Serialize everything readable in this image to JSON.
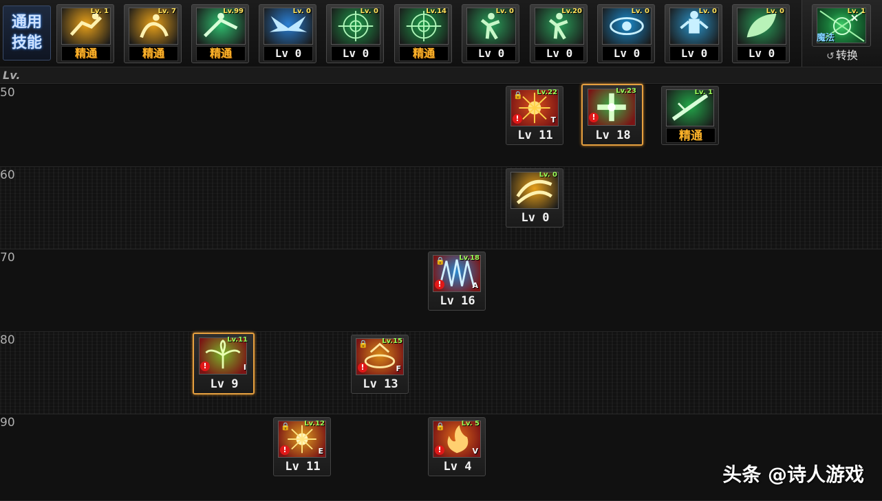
{
  "top_bar": {
    "general_label_line1": "通用",
    "general_label_line2": "技能",
    "slots": [
      {
        "icon": "runner-icon",
        "lv": "Lv. 1",
        "level": "精通",
        "color": "#e8a11a",
        "mastery": true
      },
      {
        "icon": "crouch-icon",
        "lv": "Lv. 7",
        "level": "精通",
        "color": "#e8a11a",
        "mastery": true
      },
      {
        "icon": "strike-icon",
        "lv": "Lv.99",
        "level": "精通",
        "color": "#2fbf6f",
        "mastery": true
      },
      {
        "icon": "wings-icon",
        "lv": "Lv. 0",
        "level": "Lv 0",
        "color": "#2a7fd4",
        "mastery": false
      },
      {
        "icon": "target-icon",
        "lv": "Lv. 0",
        "level": "Lv 0",
        "color": "#1e9a4a",
        "mastery": false
      },
      {
        "icon": "target-icon",
        "lv": "Lv.14",
        "level": "精通",
        "color": "#1e9a4a",
        "mastery": true
      },
      {
        "icon": "figure-icon",
        "lv": "Lv. 0",
        "level": "Lv 0",
        "color": "#2aa05a",
        "mastery": false
      },
      {
        "icon": "figure-icon",
        "lv": "Lv.20",
        "level": "Lv 0",
        "color": "#2aa05a",
        "mastery": false
      },
      {
        "icon": "eye-icon",
        "lv": "Lv. 0",
        "level": "Lv 0",
        "color": "#1a8acb",
        "mastery": false
      },
      {
        "icon": "guardian-icon",
        "lv": "Lv. 0",
        "level": "Lv 0",
        "color": "#2a93c8",
        "mastery": false
      },
      {
        "icon": "leaf-icon",
        "lv": "Lv. 0",
        "level": "Lv 0",
        "color": "#2aa05a",
        "mastery": false
      }
    ],
    "switch_panel": {
      "lv": "Lv. 1",
      "magic_label": "魔法",
      "switch_label": "转换"
    }
  },
  "lv_header": "Lv.",
  "rows": [
    {
      "label": "50"
    },
    {
      "label": "60"
    },
    {
      "label": "70"
    },
    {
      "label": "80"
    },
    {
      "label": "90"
    }
  ],
  "skills": [
    {
      "id": "s50a",
      "lv": "Lv.22",
      "level": "Lv 11",
      "key": "T",
      "locked": true,
      "warn": true,
      "selected": false,
      "color": "#d9501c",
      "icon": "burst-icon"
    },
    {
      "id": "s50b",
      "lv": "Lv.23",
      "level": "Lv 18",
      "key": "",
      "locked": false,
      "warn": true,
      "selected": true,
      "color": "#3ab04a",
      "icon": "cross-icon"
    },
    {
      "id": "s50c",
      "lv": "Lv. 1",
      "level": "精通",
      "key": "",
      "locked": false,
      "warn": false,
      "selected": false,
      "color": "#23a84a",
      "icon": "slash-icon",
      "mastery": true
    },
    {
      "id": "s60a",
      "lv": "Lv. 0",
      "level": "Lv 0",
      "key": "",
      "locked": false,
      "warn": false,
      "selected": false,
      "color": "#e8a11a",
      "icon": "twist-icon"
    },
    {
      "id": "s70a",
      "lv": "Lv.18",
      "level": "Lv 16",
      "key": "A",
      "locked": true,
      "warn": true,
      "selected": false,
      "color": "#2a8ad0",
      "icon": "spike-icon"
    },
    {
      "id": "s80a",
      "lv": "Lv.11",
      "level": "Lv 9",
      "key": "I",
      "locked": false,
      "warn": true,
      "selected": true,
      "color": "#7ab42a",
      "icon": "sprout-icon"
    },
    {
      "id": "s80b",
      "lv": "Lv.15",
      "level": "Lv 13",
      "key": "F",
      "locked": true,
      "warn": true,
      "selected": false,
      "color": "#d88a1a",
      "icon": "ring-icon"
    },
    {
      "id": "s90a",
      "lv": "Lv.12",
      "level": "Lv 11",
      "key": "E",
      "locked": true,
      "warn": true,
      "selected": false,
      "color": "#e0a020",
      "icon": "flare-icon"
    },
    {
      "id": "s90b",
      "lv": "Lv. 5",
      "level": "Lv 4",
      "key": "V",
      "locked": true,
      "warn": true,
      "selected": false,
      "color": "#e06a1a",
      "icon": "fire-icon"
    }
  ],
  "watermark": "头条 @诗人游戏"
}
